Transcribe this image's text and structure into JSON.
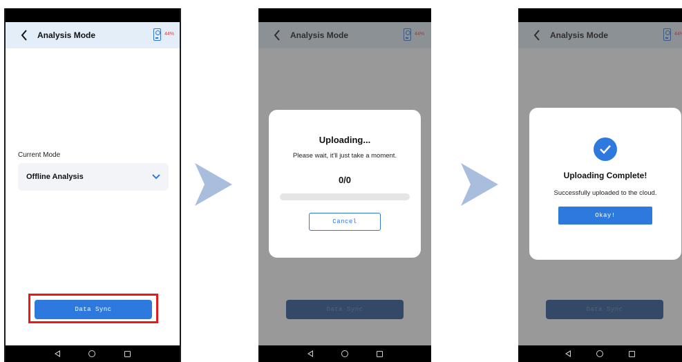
{
  "app_title": "Analysis Mode",
  "battery_level": "44%",
  "mode_label": "Current Mode",
  "mode_value": "Offline Analysis",
  "sync_button": "Data Sync",
  "upload_dialog": {
    "title": "Uploading...",
    "message": "Please wait, it'll just take a moment.",
    "count": "0/0",
    "progress": 0,
    "cancel_label": "Cancel"
  },
  "done_dialog": {
    "title": "Uploading Complete!",
    "message": "Successfully uploaded to the cloud.",
    "okay_label": "Okay!"
  },
  "colors": {
    "accent": "#2e79de",
    "highlight": "#e21b1b",
    "appbar": "#e3eef9",
    "arrow": "#a9bedd"
  }
}
